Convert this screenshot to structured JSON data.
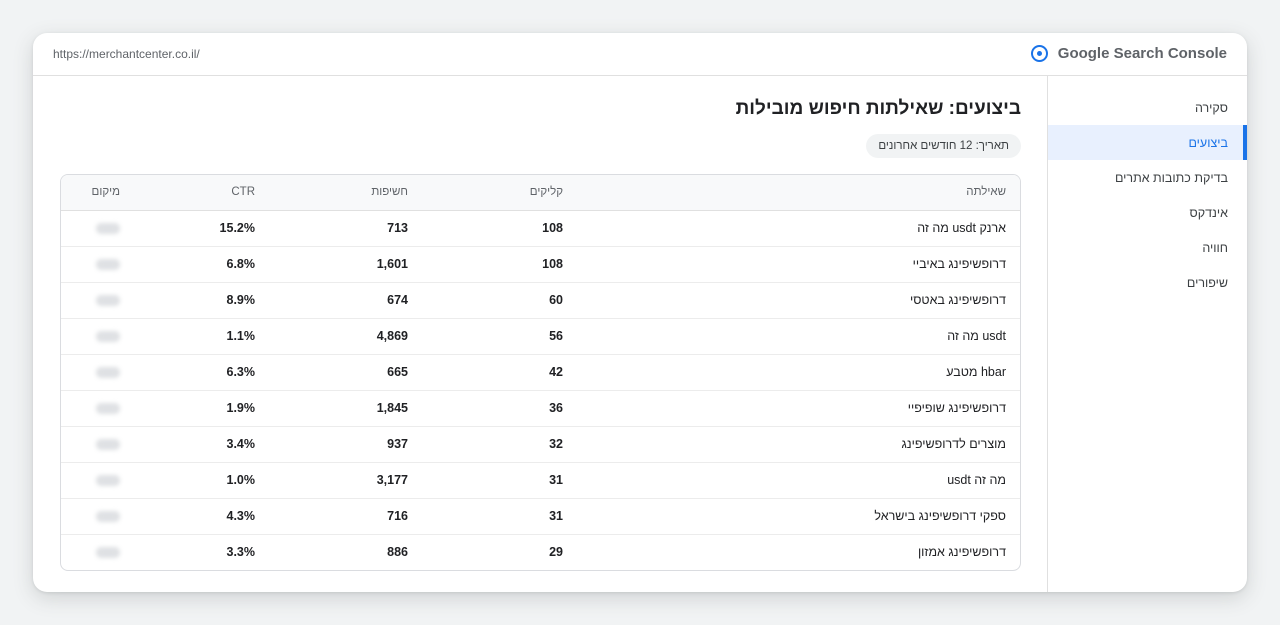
{
  "topbar": {
    "url": "https://merchantcenter.co.il/",
    "brand": "Google Search Console"
  },
  "sidebar": {
    "items": [
      {
        "label": "סקירה"
      },
      {
        "label": "ביצועים",
        "active": true
      },
      {
        "label": "בדיקת כתובות אתרים"
      },
      {
        "label": "אינדקס"
      },
      {
        "label": "חוויה"
      },
      {
        "label": "שיפורים"
      }
    ]
  },
  "main": {
    "title": "ביצועים: שאילתות חיפוש מובילות",
    "date_chip": "תאריך: 12 חודשים אחרונים",
    "table": {
      "headers": {
        "query": "שאילתה",
        "clicks": "קליקים",
        "impressions": "חשיפות",
        "ctr": "CTR",
        "position": "מיקום"
      },
      "rows": [
        {
          "query": "ארנק usdt מה זה",
          "clicks": "108",
          "impressions": "713",
          "ctr": "15.2%"
        },
        {
          "query": "דרופשיפינג באיביי",
          "clicks": "108",
          "impressions": "1,601",
          "ctr": "6.8%"
        },
        {
          "query": "דרופשיפינג באטסי",
          "clicks": "60",
          "impressions": "674",
          "ctr": "8.9%"
        },
        {
          "query": "usdt מה זה",
          "clicks": "56",
          "impressions": "4,869",
          "ctr": "1.1%"
        },
        {
          "query": "hbar מטבע",
          "clicks": "42",
          "impressions": "665",
          "ctr": "6.3%"
        },
        {
          "query": "דרופשיפינג שופיפיי",
          "clicks": "36",
          "impressions": "1,845",
          "ctr": "1.9%"
        },
        {
          "query": "מוצרים לדרופשיפינג",
          "clicks": "32",
          "impressions": "937",
          "ctr": "3.4%"
        },
        {
          "query": "מה זה usdt",
          "clicks": "31",
          "impressions": "3,177",
          "ctr": "1.0%"
        },
        {
          "query": "ספקי דרופשיפינג בישראל",
          "clicks": "31",
          "impressions": "716",
          "ctr": "4.3%"
        },
        {
          "query": "דרופשיפינג אמזון",
          "clicks": "29",
          "impressions": "886",
          "ctr": "3.3%"
        }
      ]
    }
  }
}
